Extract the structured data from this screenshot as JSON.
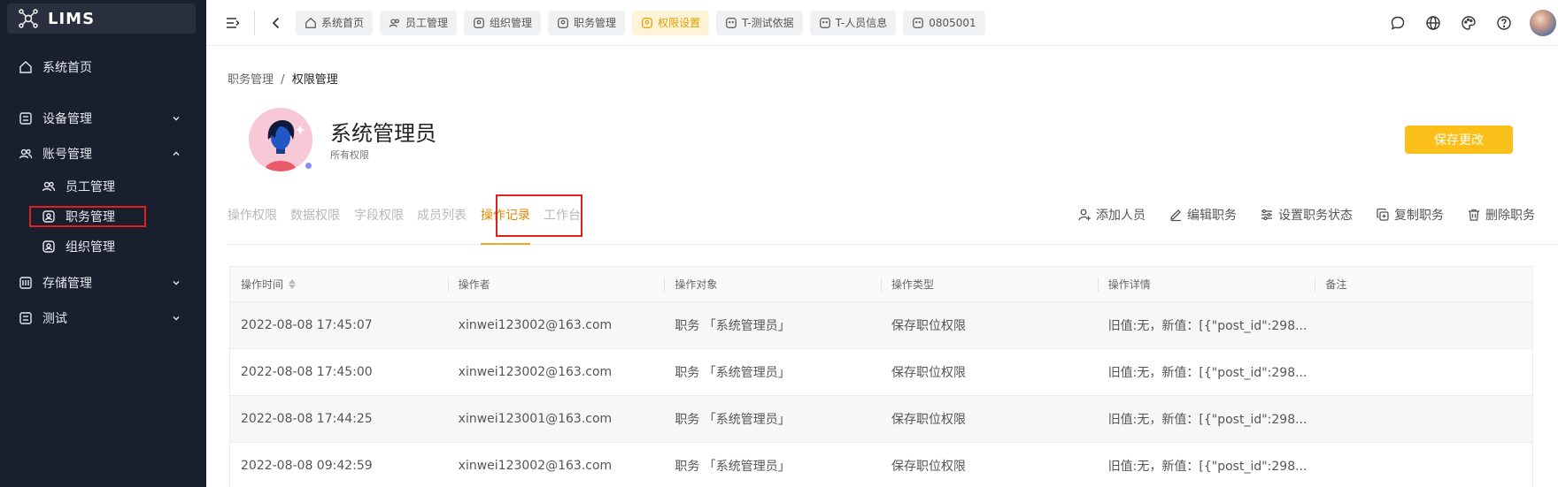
{
  "app": {
    "name": "LIMS"
  },
  "sidebar": {
    "items": [
      {
        "label": "系统首页",
        "icon": "home-icon"
      },
      {
        "label": "设备管理",
        "icon": "grid-icon",
        "expanded": false
      },
      {
        "label": "账号管理",
        "icon": "users-icon",
        "expanded": true,
        "children": [
          {
            "label": "员工管理",
            "icon": "users-icon"
          },
          {
            "label": "职务管理",
            "icon": "badge-icon",
            "active": true
          },
          {
            "label": "组织管理",
            "icon": "badge-icon"
          }
        ]
      },
      {
        "label": "存储管理",
        "icon": "storage-icon",
        "expanded": false
      },
      {
        "label": "测试",
        "icon": "grid-icon",
        "expanded": false
      }
    ]
  },
  "topbar": {
    "tabs": [
      {
        "label": "系统首页",
        "icon": "home-icon"
      },
      {
        "label": "员工管理",
        "icon": "users-icon"
      },
      {
        "label": "组织管理",
        "icon": "badge-icon"
      },
      {
        "label": "职务管理",
        "icon": "badge-icon"
      },
      {
        "label": "权限设置",
        "icon": "badge-icon",
        "active": true
      },
      {
        "label": "T-测试依据",
        "icon": "grid-icon"
      },
      {
        "label": "T-人员信息",
        "icon": "grid-icon"
      },
      {
        "label": "0805001",
        "icon": "grid-icon"
      }
    ],
    "right_icons": [
      "message-icon",
      "globe-icon",
      "palette-icon",
      "help-icon"
    ]
  },
  "breadcrumb": {
    "parent": "职务管理",
    "separator": "/",
    "current": "权限管理"
  },
  "role": {
    "title": "系统管理员",
    "subtitle": "所有权限"
  },
  "save_button": "保存更改",
  "page_tabs": [
    {
      "label": "操作权限"
    },
    {
      "label": "数据权限"
    },
    {
      "label": "字段权限"
    },
    {
      "label": "成员列表"
    },
    {
      "label": "操作记录",
      "active": true
    },
    {
      "label": "工作台"
    }
  ],
  "actions": [
    {
      "label": "添加人员",
      "icon": "add-user-icon"
    },
    {
      "label": "编辑职务",
      "icon": "edit-icon"
    },
    {
      "label": "设置职务状态",
      "icon": "sliders-icon"
    },
    {
      "label": "复制职务",
      "icon": "copy-icon"
    },
    {
      "label": "删除职务",
      "icon": "trash-icon"
    }
  ],
  "table": {
    "columns": [
      "操作时间",
      "操作者",
      "操作对象",
      "操作类型",
      "操作详情",
      "备注"
    ],
    "rows": [
      [
        "2022-08-08 17:45:07",
        "xinwei123002@163.com",
        "职务 「系统管理员」",
        "保存职位权限",
        "旧值:无，新值：[{\"post_id\":298...",
        ""
      ],
      [
        "2022-08-08 17:45:00",
        "xinwei123002@163.com",
        "职务 「系统管理员」",
        "保存职位权限",
        "旧值:无，新值：[{\"post_id\":298...",
        ""
      ],
      [
        "2022-08-08 17:44:25",
        "xinwei123001@163.com",
        "职务 「系统管理员」",
        "保存职位权限",
        "旧值:无，新值：[{\"post_id\":298...",
        ""
      ],
      [
        "2022-08-08 09:42:59",
        "xinwei123002@163.com",
        "职务 「系统管理员」",
        "保存职位权限",
        "旧值:无，新值：[{\"post_id\":298...",
        ""
      ]
    ]
  },
  "colors": {
    "accent": "#fbbf1a",
    "sidebar_bg": "#1a1f2e",
    "active_tab": "#e08a00",
    "highlight": "#e02020"
  }
}
